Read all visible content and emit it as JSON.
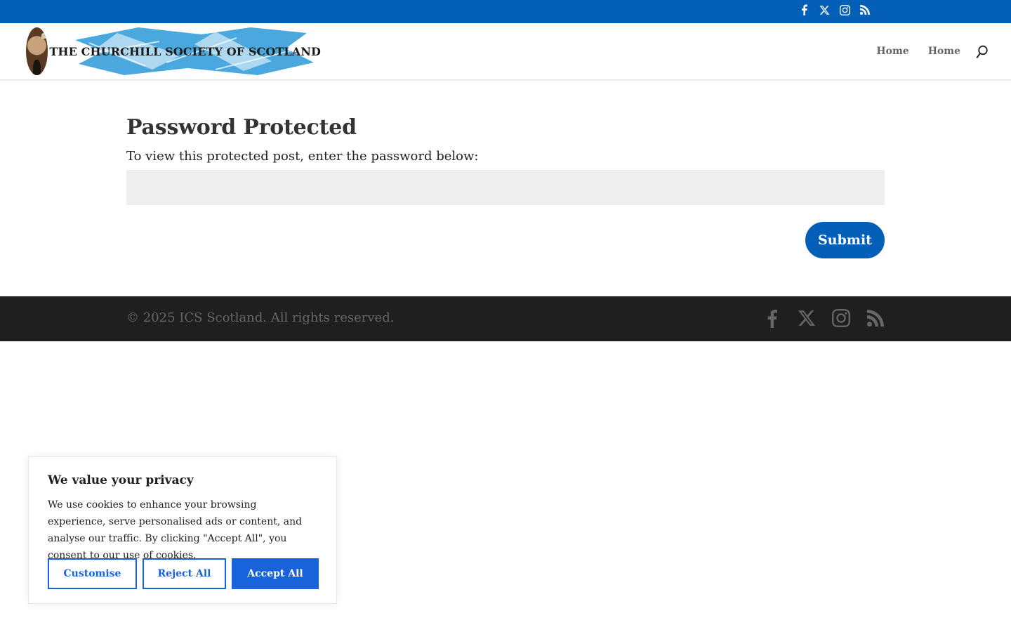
{
  "colors": {
    "brand_blue": "#035fb8",
    "footer_bg": "#1f1f1f",
    "cookie_accent": "#1863dc"
  },
  "top_bar": {
    "social_icons": [
      "facebook-icon",
      "x-twitter-icon",
      "instagram-icon",
      "rss-icon"
    ]
  },
  "header": {
    "logo_text": "THE CHURCHILL SOCIETY OF SCOTLAND",
    "nav": [
      {
        "label": "Home"
      },
      {
        "label": "Home"
      }
    ],
    "search_icon": "search-icon"
  },
  "main": {
    "title": "Password Protected",
    "intro": "To view this protected post, enter the password below:",
    "password_value": "",
    "submit_label": "Submit"
  },
  "footer": {
    "copyright": "© 2025 ICS Scotland. All rights reserved.",
    "social_icons": [
      "facebook-icon",
      "x-twitter-icon",
      "instagram-icon",
      "rss-icon"
    ]
  },
  "cookie": {
    "title": "We value your privacy",
    "text": "We use cookies to enhance your browsing experience, serve personalised ads or content, and analyse our traffic. By clicking \"Accept All\", you consent to our use of cookies.",
    "customise_label": "Customise",
    "reject_label": "Reject All",
    "accept_label": "Accept All"
  }
}
